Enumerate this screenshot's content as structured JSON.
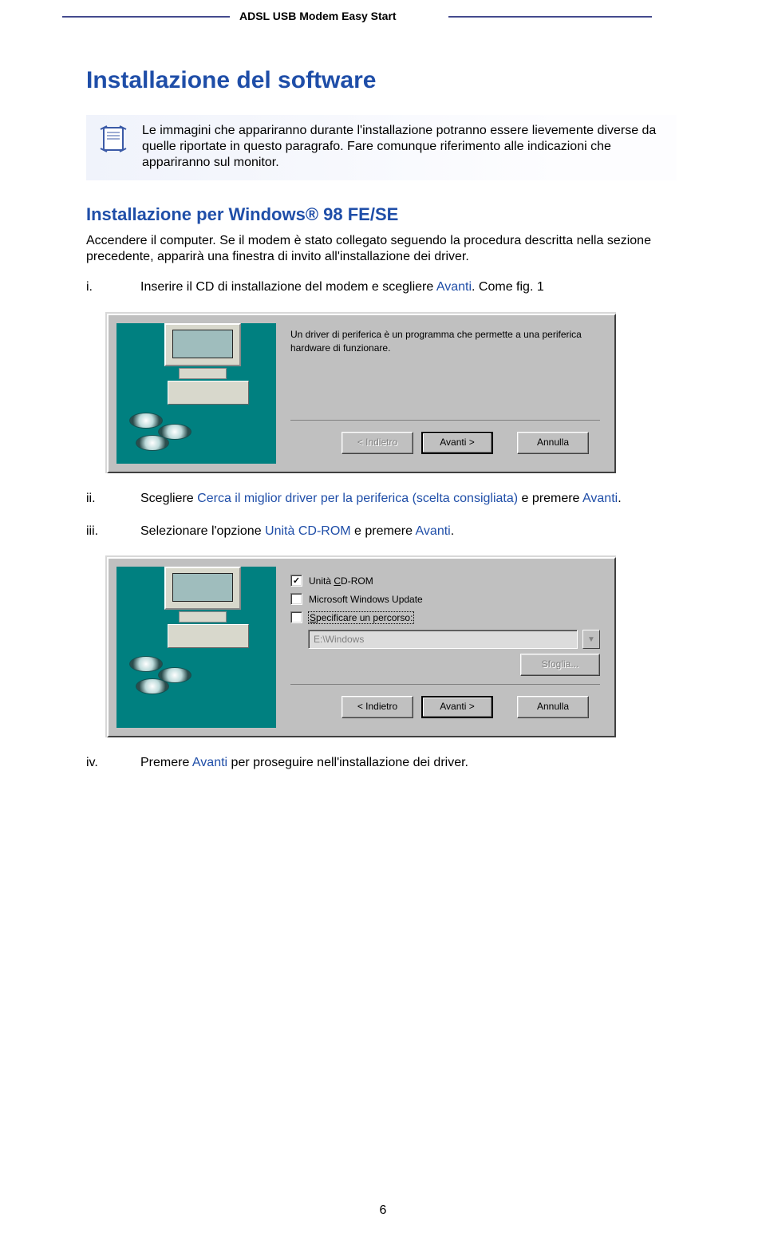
{
  "header": {
    "title": "ADSL USB Modem Easy Start"
  },
  "main_heading": "Installazione del software",
  "note": {
    "text": "Le immagini che appariranno durante l'installazione potranno essere lievemente diverse da quelle riportate in questo paragrafo. Fare comunque riferimento alle indicazioni che appariranno sul monitor."
  },
  "section_heading": "Installazione per Windows® 98 FE/SE",
  "intro": "Accendere il computer. Se il modem è stato collegato seguendo la procedura descritta nella sezione precedente, apparirà una finestra di invito all'installazione dei driver.",
  "steps": {
    "i": {
      "num": "i.",
      "pre": "Inserire il CD di installazione del modem e scegliere ",
      "blue": "Avanti",
      "post": ". Come fig. 1"
    },
    "ii": {
      "num": "ii.",
      "pre": "Scegliere ",
      "blue1": "Cerca il miglior driver per la periferica (scelta consigliata)",
      "mid": " e premere ",
      "blue2": "Avanti",
      "post": "."
    },
    "iii": {
      "num": "iii.",
      "pre": "Selezionare l'opzione ",
      "blue1": "Unità CD-ROM",
      "mid": " e premere ",
      "blue2": "Avanti",
      "post": "."
    },
    "iv": {
      "num": "iv.",
      "pre": "Premere ",
      "blue": "Avanti ",
      "post": " per proseguire nell'installazione dei driver."
    }
  },
  "dialog1": {
    "body": "Un driver di periferica è un programma che permette a una periferica hardware di funzionare.",
    "btn_back": "< Indietro",
    "btn_next": "Avanti >",
    "btn_cancel": "Annulla"
  },
  "dialog2": {
    "cd_label_prefix": "Unità ",
    "cd_label_u": "C",
    "cd_label_suffix": "D-ROM",
    "win_update": "Microsoft Windows Update",
    "path_label_u": "S",
    "path_label_suffix": "pecificare un percorso:",
    "path_value": "E:\\Windows",
    "browse": "Sfoglia...",
    "btn_back": "< Indietro",
    "btn_next": "Avanti >",
    "btn_cancel": "Annulla"
  },
  "page_number": "6"
}
